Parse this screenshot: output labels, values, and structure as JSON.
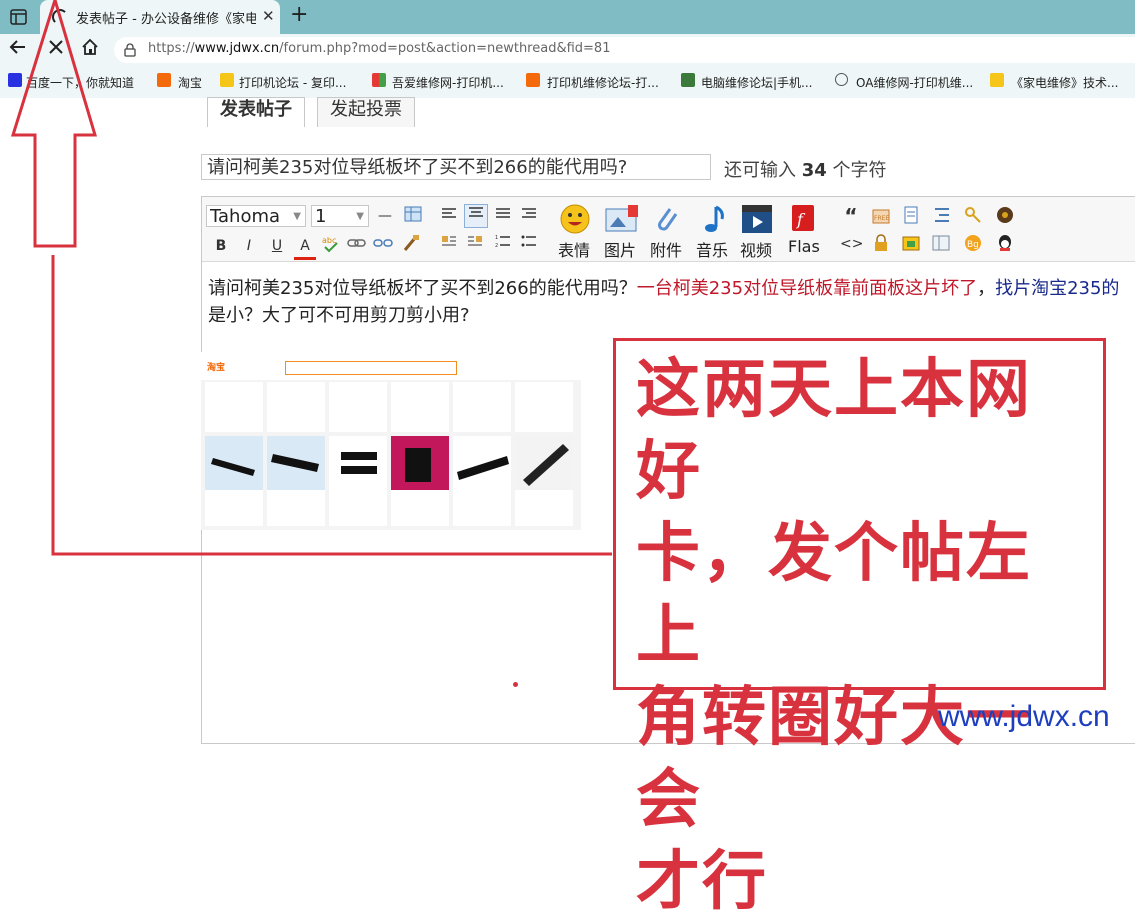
{
  "browser": {
    "tab_title": "发表帖子 - 办公设备维修《家电维",
    "tab_close": "✕",
    "new_tab": "+",
    "url_prefix": "https://",
    "url_host": "www.jdwx.cn",
    "url_path": "/forum.php?mod=post&action=newthread&fid=81",
    "icons": [
      "window-icon",
      "loading-spinner-icon",
      "back-icon",
      "close-icon",
      "home-icon",
      "lock-icon"
    ]
  },
  "bookmarks": [
    {
      "label": "百度一下，你就知道",
      "color": "#2932e1"
    },
    {
      "label": "淘宝",
      "color": "#f46a0a"
    },
    {
      "label": "打印机论坛 - 复印...",
      "color": "#f5c518"
    },
    {
      "label": "吾爱维修网-打印机...",
      "color": "#e53935"
    },
    {
      "label": "打印机维修论坛-打...",
      "color": "#f46a0a"
    },
    {
      "label": "电脑维修论坛|手机...",
      "color": "#3c7a3c"
    },
    {
      "label": "OA维修网-打印机维...",
      "color": "#555555"
    },
    {
      "label": "《家电维修》技术...",
      "color": "#f5c518"
    }
  ],
  "post_tabs": [
    "发表帖子",
    "发起投票"
  ],
  "subject": {
    "value": "请问柯美235对位导纸板坏了买不到266的能代用吗?",
    "remaining_prefix": "还可输入",
    "remaining_count": "34",
    "remaining_suffix": "个字符"
  },
  "toolbar": {
    "font": "Tahoma",
    "size": "1",
    "labels": [
      "表情",
      "图片",
      "附件",
      "音乐",
      "视频",
      "Flas"
    ],
    "format_buttons": [
      "B",
      "I",
      "U",
      "A"
    ]
  },
  "body": {
    "line1_black": "请问柯美235对位导纸板坏了买不到266的能代用吗？",
    "line1_red": "一台柯美235对位导纸板靠前面板这片坏了",
    "line1_sep": "，",
    "line1_blue": "找片淘宝235的",
    "line2": "是小？大了可不可用剪刀剪小用?"
  },
  "annotation": {
    "text": "这两天上本网好卡，发个帖左上角转圈好大一会才行",
    "lines": [
      "这两天上本网好",
      "卡，发个帖左上",
      "角转圈好大一会",
      "才行"
    ],
    "color": "#d8323f"
  },
  "screenshot_logo": "淘宝",
  "watermark": "www.jdwx.cn"
}
